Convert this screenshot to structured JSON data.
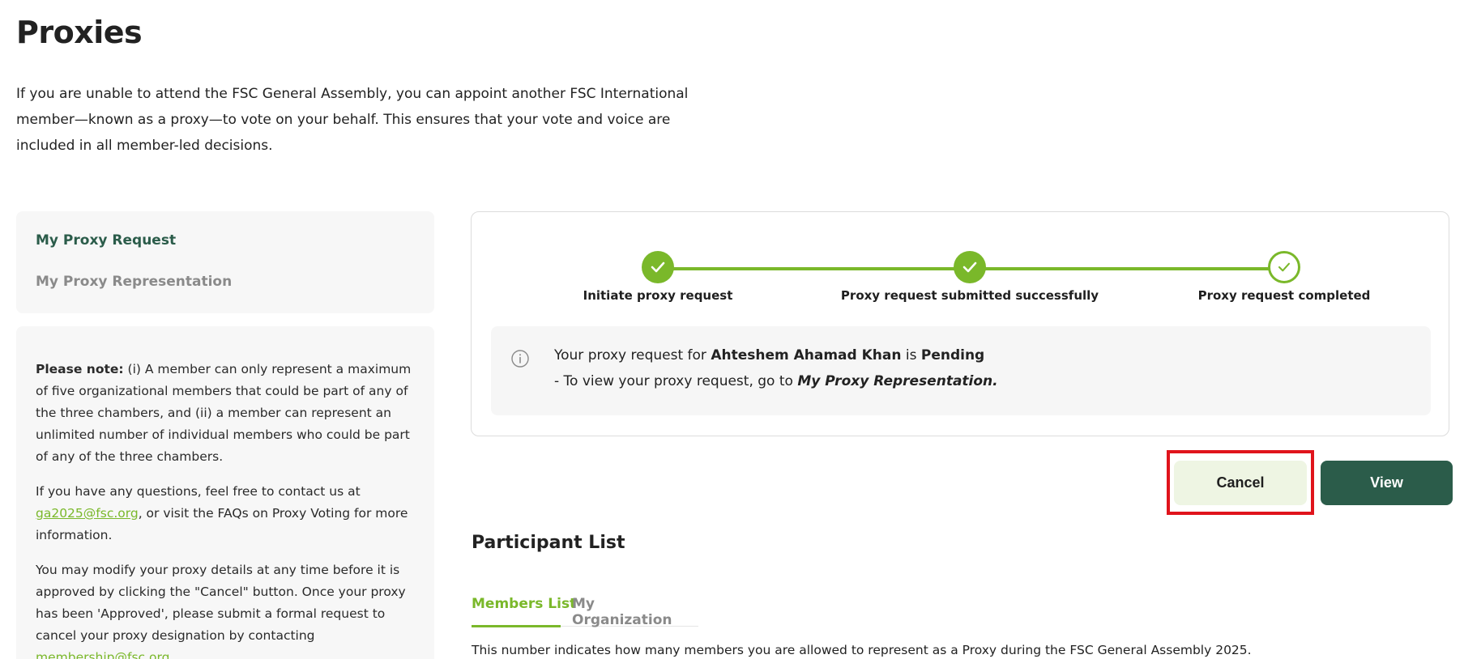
{
  "page": {
    "title": "Proxies",
    "intro": "If you are unable to attend the FSC General Assembly, you can appoint another FSC International member—known as a proxy—to vote on your behalf. This ensures that your vote and voice are included in all member-led decisions."
  },
  "nav": {
    "items": [
      {
        "label": "My Proxy Request",
        "active": true
      },
      {
        "label": "My Proxy Representation",
        "active": false
      }
    ]
  },
  "note": {
    "label": "Please note:",
    "text1": " (i) A member can only represent a maximum of five organizational members that could be part of any of the three chambers, and (ii) a member can represent an unlimited number of individual members who could be part of any of the three chambers.",
    "contact_prefix": "If you have any questions, feel free to contact us at ",
    "contact_email": "ga2025@fsc.org",
    "contact_suffix": ", or visit the FAQs on Proxy Voting for more information.",
    "modify_text": "You may modify your proxy details at any time before it is approved by clicking the \"Cancel\" button. Once your proxy has been 'Approved', please submit a formal request to cancel your proxy designation by contacting ",
    "membership_email": "membership@fsc.org"
  },
  "stepper": {
    "steps": [
      {
        "label": "Initiate proxy request",
        "status": "done"
      },
      {
        "label": "Proxy request submitted successfully",
        "status": "done"
      },
      {
        "label": "Proxy request completed",
        "status": "outline"
      }
    ],
    "color": "#7ab82a"
  },
  "info": {
    "line1_prefix": "Your proxy request for ",
    "member_name": "Ahteshem Ahamad Khan",
    "line1_mid": " is ",
    "status": "Pending",
    "line2_prefix": "- To view your proxy request, go to ",
    "line2_link": "My Proxy Representation."
  },
  "actions": {
    "cancel_label": "Cancel",
    "view_label": "View"
  },
  "participants": {
    "title": "Participant List",
    "tabs": [
      {
        "label": "Members List",
        "active": true
      },
      {
        "label": "My Organization",
        "active": false
      }
    ],
    "footnote": "This number indicates how many members you are allowed to represent as a Proxy during the FSC General Assembly 2025."
  },
  "colors": {
    "accent_green": "#7ab82a",
    "dark_green": "#2b5c4a",
    "highlight_red": "#e0141c"
  }
}
